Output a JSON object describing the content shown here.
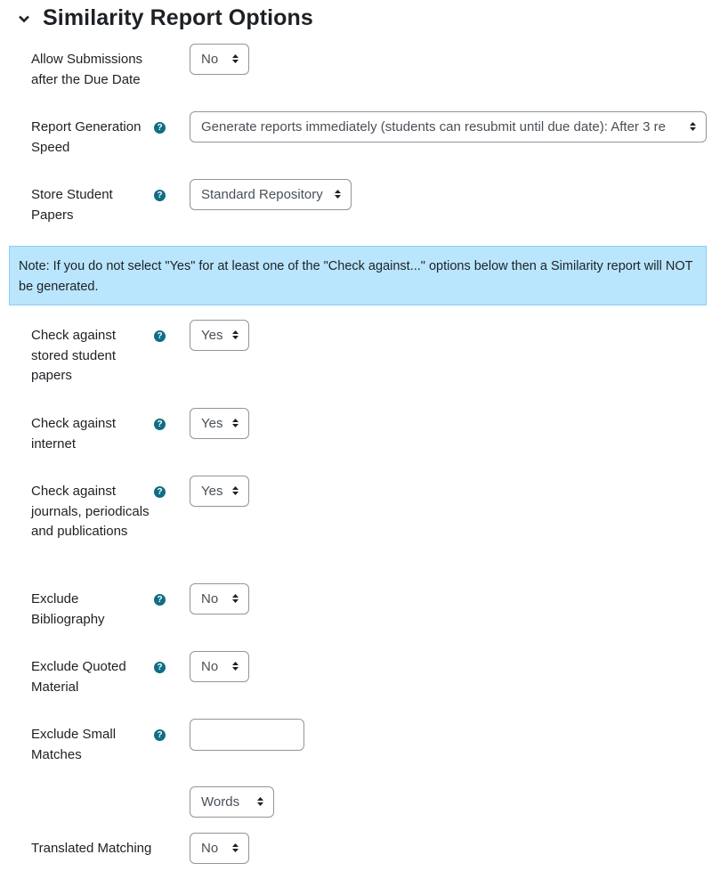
{
  "section": {
    "title": "Similarity Report Options",
    "icon": "chevron-down-icon"
  },
  "rows_top": [
    {
      "label": "Allow Submissions after the Due Date",
      "value": "No",
      "help": false
    },
    {
      "label": "Report Generation Speed",
      "value": "Generate reports immediately (students can resubmit until due date): After 3 re",
      "help": true
    },
    {
      "label": "Store Student Papers",
      "value": "Standard Repository",
      "help": true
    }
  ],
  "note": "Note: If you do not select \"Yes\" for at least one of the \"Check against...\" options below then a Similarity report will NOT be generated.",
  "rows": [
    {
      "label": "Check against stored student papers",
      "value": "Yes"
    },
    {
      "label": "Check against internet",
      "value": "Yes"
    },
    {
      "label": "Check against journals, periodicals and publications",
      "value": "Yes"
    },
    {
      "label": "Exclude Bibliography",
      "value": "No"
    },
    {
      "label": "Exclude Quoted Material",
      "value": "No"
    },
    {
      "label": "Exclude Small Matches",
      "input_value": ""
    },
    {
      "unit": "Words"
    },
    {
      "label": "Translated Matching",
      "value": "No"
    }
  ],
  "colors": {
    "help": "#0f6e84",
    "note_bg": "#b9e5fd"
  }
}
